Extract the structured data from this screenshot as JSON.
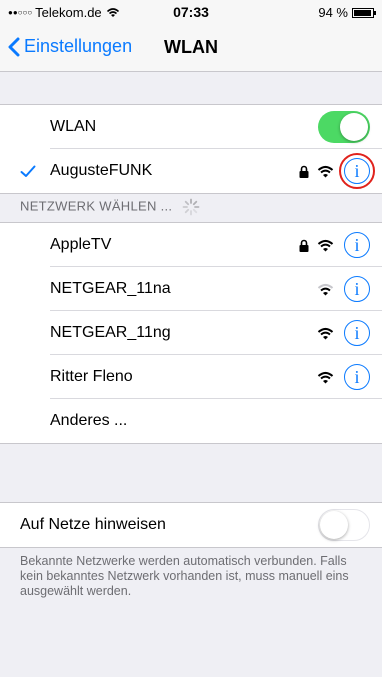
{
  "status_bar": {
    "carrier": "Telekom.de",
    "time": "07:33",
    "battery_text": "94 %",
    "battery_level": 0.94
  },
  "nav": {
    "back_label": "Einstellungen",
    "title": "WLAN"
  },
  "wlan_toggle": {
    "label": "WLAN",
    "state": "on"
  },
  "connected_network": {
    "name": "AugusteFUNK",
    "secured": true,
    "checked": true
  },
  "choose_network_header": "NETZWERK WÄHLEN ...",
  "networks": [
    {
      "name": "AppleTV",
      "secured": true
    },
    {
      "name": "NETGEAR_11na",
      "secured": false
    },
    {
      "name": "NETGEAR_11ng",
      "secured": false
    },
    {
      "name": "Ritter Fleno",
      "secured": false
    }
  ],
  "other_network": "Anderes ...",
  "ask_to_join": {
    "label": "Auf Netze hinweisen",
    "state": "off"
  },
  "footer_text": "Bekannte Netzwerke werden automatisch verbunden. Falls kein bekanntes Netzwerk vorhanden ist, muss manuell eins ausgewählt werden.",
  "icons": {
    "back": "chevron-left-icon",
    "checkmark": "checkmark-icon",
    "lock": "lock-icon",
    "wifi": "wifi-icon",
    "info": "info-icon",
    "spinner": "spinner-icon"
  },
  "colors": {
    "accent": "#0a7aff",
    "toggle_on": "#4cd964",
    "highlight": "#e0221c"
  }
}
